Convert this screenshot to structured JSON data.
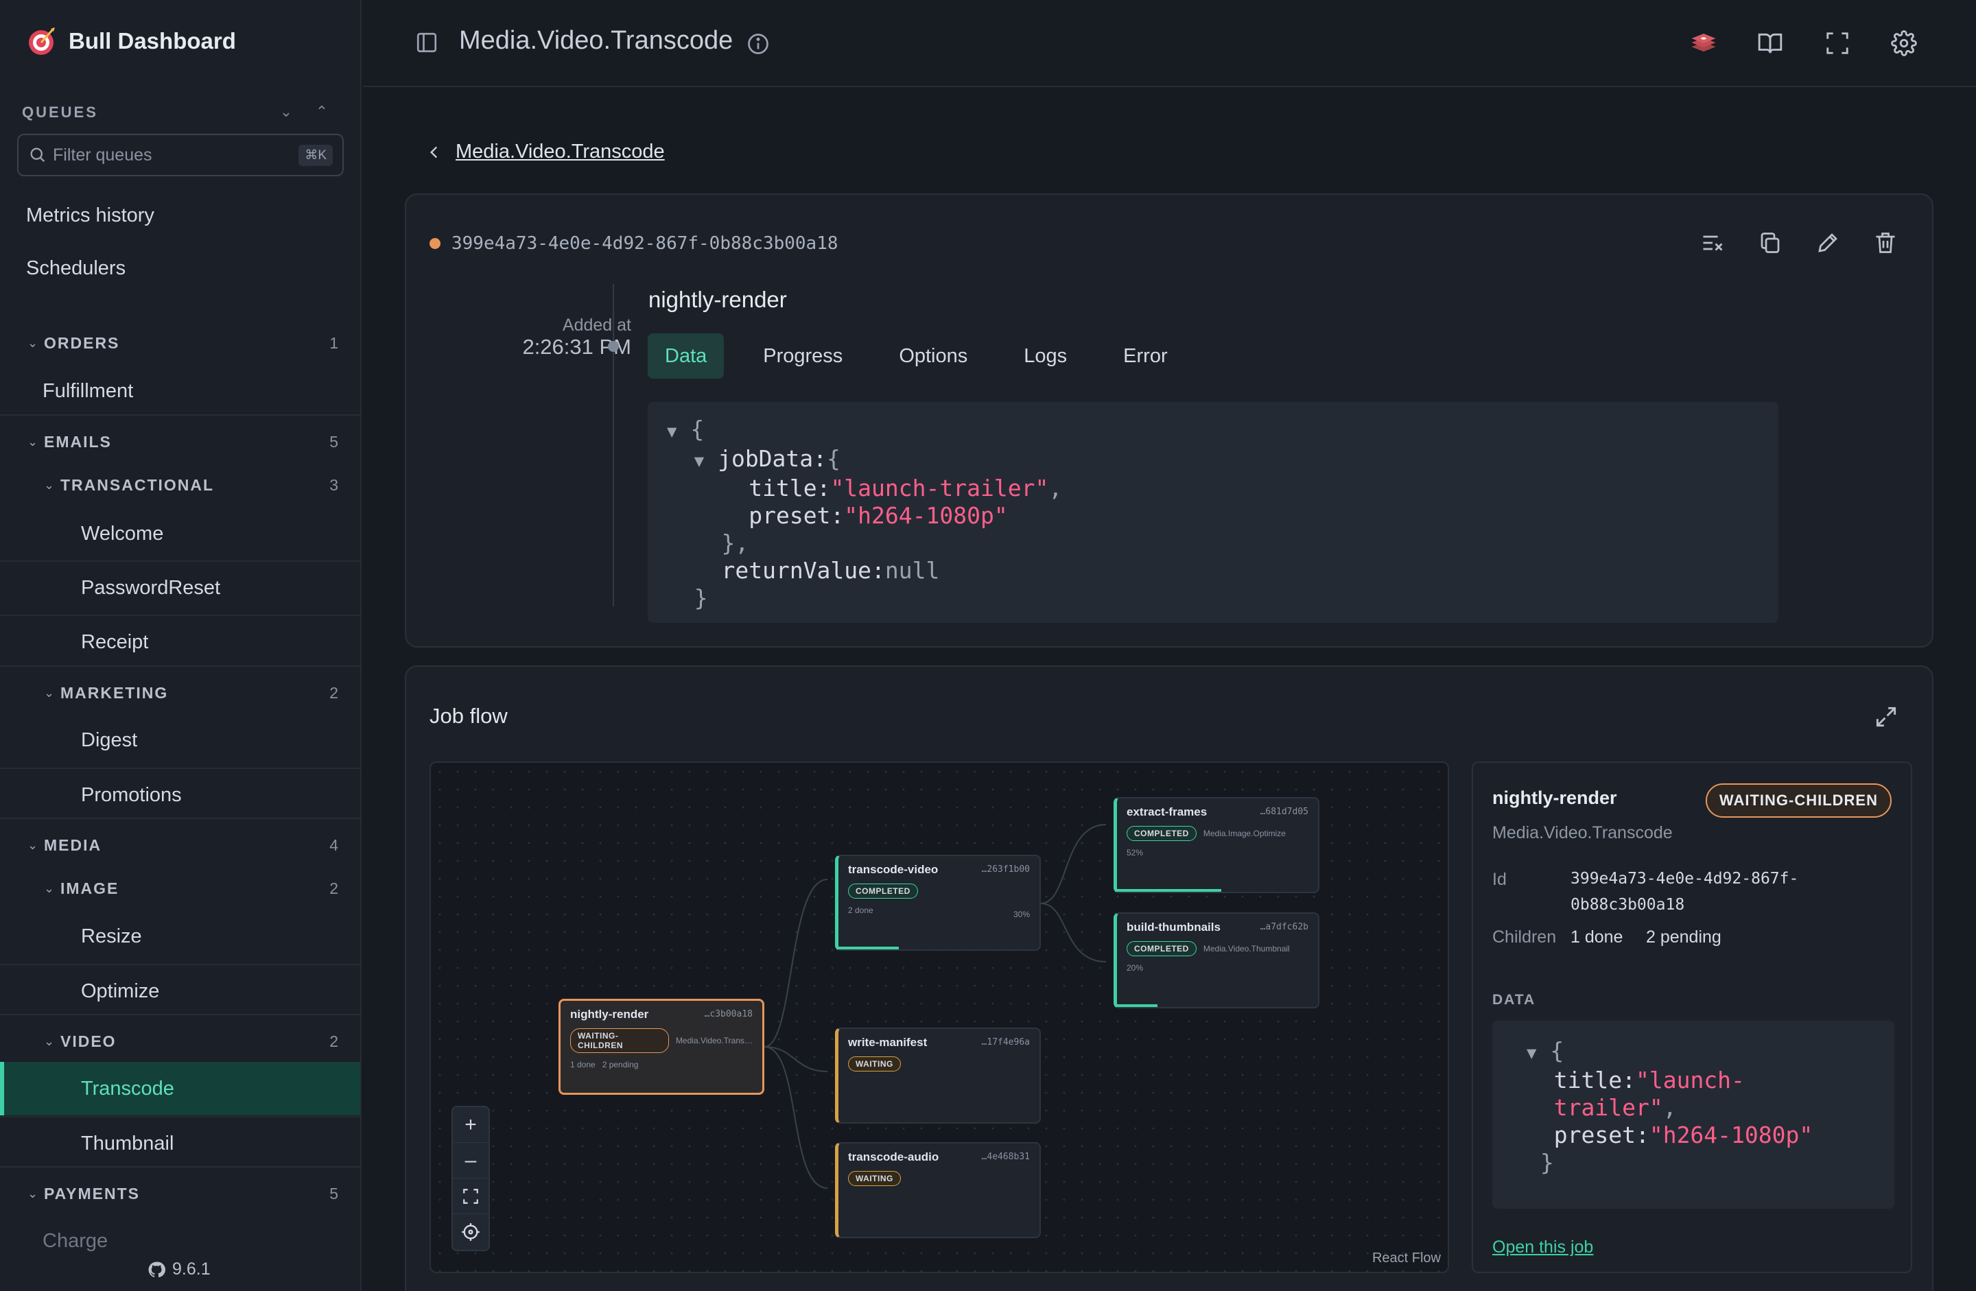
{
  "app": {
    "title": "Bull Dashboard",
    "version": "9.6.1"
  },
  "sidebar": {
    "queues_label": "QUEUES",
    "filter_placeholder": "Filter queues",
    "filter_shortcut": "⌘K",
    "links": [
      "Metrics history",
      "Schedulers"
    ],
    "groups": {
      "orders": {
        "name": "ORDERS",
        "count": "1",
        "items": [
          "Fulfillment"
        ]
      },
      "emails": {
        "name": "EMAILS",
        "count": "5"
      },
      "transactional": {
        "name": "TRANSACTIONAL",
        "count": "3",
        "items": [
          "Welcome",
          "PasswordReset",
          "Receipt"
        ]
      },
      "marketing": {
        "name": "MARKETING",
        "count": "2",
        "items": [
          "Digest",
          "Promotions"
        ]
      },
      "media": {
        "name": "MEDIA",
        "count": "4"
      },
      "image": {
        "name": "IMAGE",
        "count": "2",
        "items": [
          "Resize",
          "Optimize"
        ]
      },
      "video": {
        "name": "VIDEO",
        "count": "2",
        "items": [
          "Transcode",
          "Thumbnail"
        ]
      },
      "payments": {
        "name": "PAYMENTS",
        "count": "5",
        "items": [
          "Charge"
        ]
      }
    },
    "active_item": "Transcode"
  },
  "header": {
    "title": "Media.Video.Transcode"
  },
  "breadcrumb": {
    "back_label": "Media.Video.Transcode"
  },
  "job": {
    "id": "399e4a73-4e0e-4d92-867f-0b88c3b00a18",
    "name": "nightly-render",
    "added_label": "Added at",
    "added_time": "2:26:31 PM",
    "status_color": "#e8955a",
    "tabs": [
      "Data",
      "Progress",
      "Options",
      "Logs",
      "Error"
    ],
    "active_tab": "Data",
    "data": {
      "key_jobData": "jobData:",
      "key_title": "title:",
      "val_title": "\"launch-trailer\"",
      "key_preset": "preset:",
      "val_preset": "\"h264-1080p\"",
      "key_returnValue": "returnValue:",
      "val_returnValue": "null"
    }
  },
  "flow": {
    "title": "Job flow",
    "attribution": "React Flow",
    "nodes": {
      "root": {
        "name": "nightly-render",
        "id": "…c3b00a18",
        "status": "WAITING-CHILDREN",
        "queue": "Media.Video.Trans…",
        "done": "1 done",
        "pending": "2 pending"
      },
      "transcode_video": {
        "name": "transcode-video",
        "id": "…263f1b00",
        "status": "COMPLETED",
        "meta": "2 done",
        "pct": "30%",
        "progress": 0.3
      },
      "write_manifest": {
        "name": "write-manifest",
        "id": "…17f4e96a",
        "status": "WAITING"
      },
      "transcode_audio": {
        "name": "transcode-audio",
        "id": "…4e468b31",
        "status": "WAITING"
      },
      "extract_frames": {
        "name": "extract-frames",
        "id": "…681d7d05",
        "status": "COMPLETED",
        "queue": "Media.Image.Optimize",
        "pct": "52%",
        "progress": 0.52
      },
      "build_thumbnails": {
        "name": "build-thumbnails",
        "id": "…a7dfc62b",
        "status": "COMPLETED",
        "queue": "Media.Video.Thumbnail",
        "pct": "20%",
        "progress": 0.2
      }
    }
  },
  "detail": {
    "name": "nightly-render",
    "status": "WAITING-CHILDREN",
    "queue": "Media.Video.Transcode",
    "id_label": "Id",
    "id_line1": "399e4a73-4e0e-4d92-867f-",
    "id_line2": "0b88c3b00a18",
    "children_label": "Children",
    "children_done": "1 done",
    "children_pending": "2 pending",
    "data_label": "DATA",
    "json": {
      "key_title": "title:",
      "val_title_1": "\"launch-",
      "val_title_2": "trailer\"",
      "key_preset": "preset:",
      "val_preset": "\"h264-1080p\""
    },
    "open_link": "Open this job"
  }
}
